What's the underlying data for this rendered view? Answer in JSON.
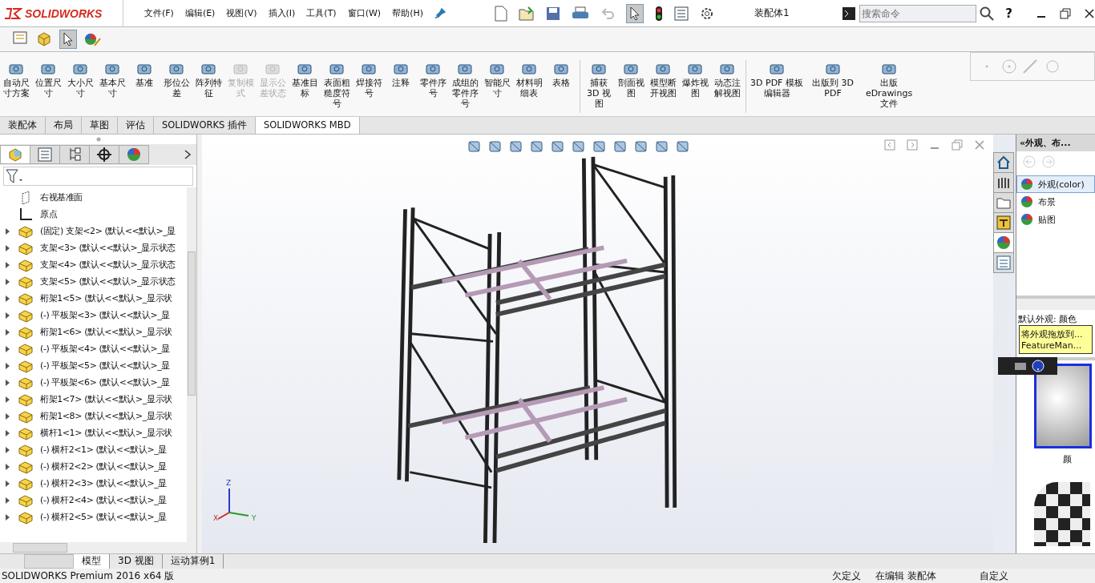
{
  "app": {
    "logo": "SOLIDWORKS",
    "menus": [
      "文件(F)",
      "编辑(E)",
      "视图(V)",
      "插入(I)",
      "工具(T)",
      "窗口(W)",
      "帮助(H)"
    ],
    "document_title": "装配体1",
    "search": {
      "placeholder": "搜索命令"
    },
    "help": "?"
  },
  "ribbon": {
    "groups": [
      [
        {
          "label": "自动尺寸方案",
          "disabled": false
        },
        {
          "label": "位置尺寸",
          "disabled": false
        },
        {
          "label": "大小尺寸",
          "disabled": false
        },
        {
          "label": "基本尺寸",
          "disabled": false
        },
        {
          "label": "基准",
          "disabled": false
        },
        {
          "label": "形位公差",
          "disabled": false
        },
        {
          "label": "阵列特征",
          "disabled": false
        },
        {
          "label": "复制模式",
          "disabled": true
        },
        {
          "label": "显示公差状态",
          "disabled": true
        },
        {
          "label": "基准目标",
          "disabled": false
        },
        {
          "label": "表面粗糙度符号",
          "disabled": false
        },
        {
          "label": "焊接符号",
          "disabled": false
        },
        {
          "label": "注释",
          "disabled": false
        },
        {
          "label": "零件序号",
          "disabled": false
        },
        {
          "label": "成组的零件序号",
          "disabled": false
        },
        {
          "label": "智能尺寸",
          "disabled": false
        },
        {
          "label": "材料明细表",
          "disabled": false
        },
        {
          "label": "表格",
          "disabled": false
        }
      ],
      [
        {
          "label": "捕获 3D 视图",
          "disabled": false
        },
        {
          "label": "剖面视图",
          "disabled": false
        },
        {
          "label": "模型断开视图",
          "disabled": false
        },
        {
          "label": "爆炸视图",
          "disabled": false
        },
        {
          "label": "动态注解视图",
          "disabled": false
        }
      ],
      [
        {
          "label": "3D PDF 模板编辑器",
          "disabled": false
        },
        {
          "label": "出版到 3D PDF",
          "disabled": false
        },
        {
          "label": "出版 eDrawings 文件",
          "disabled": false
        }
      ]
    ]
  },
  "command_tabs": [
    {
      "label": "装配体",
      "selected": false
    },
    {
      "label": "布局",
      "selected": false
    },
    {
      "label": "草图",
      "selected": false
    },
    {
      "label": "评估",
      "selected": false
    },
    {
      "label": "SOLIDWORKS 插件",
      "selected": false
    },
    {
      "label": "SOLIDWORKS MBD",
      "selected": true
    }
  ],
  "panel_tabs": [
    {
      "kind": "tree",
      "selected": true
    },
    {
      "kind": "properties",
      "selected": false
    },
    {
      "kind": "config",
      "selected": false
    },
    {
      "kind": "target",
      "selected": false
    },
    {
      "kind": "appearance",
      "selected": false
    }
  ],
  "feature_tree": [
    {
      "kind": "plane",
      "label": "右视基准面"
    },
    {
      "kind": "origin",
      "label": "原点"
    },
    {
      "kind": "component",
      "label": "(固定) 支架<2> (默认<<默认>_显"
    },
    {
      "kind": "component",
      "label": "支架<3> (默认<<默认>_显示状态"
    },
    {
      "kind": "component",
      "label": "支架<4> (默认<<默认>_显示状态"
    },
    {
      "kind": "component",
      "label": "支架<5> (默认<<默认>_显示状态"
    },
    {
      "kind": "component",
      "label": "桁架1<5> (默认<<默认>_显示状"
    },
    {
      "kind": "component",
      "label": "(-) 平板架<3> (默认<<默认>_显"
    },
    {
      "kind": "component",
      "label": "桁架1<6> (默认<<默认>_显示状"
    },
    {
      "kind": "component",
      "label": "(-) 平板架<4> (默认<<默认>_显"
    },
    {
      "kind": "component",
      "label": "(-) 平板架<5> (默认<<默认>_显"
    },
    {
      "kind": "component",
      "label": "(-) 平板架<6> (默认<<默认>_显"
    },
    {
      "kind": "component",
      "label": "桁架1<7> (默认<<默认>_显示状"
    },
    {
      "kind": "component",
      "label": "桁架1<8> (默认<<默认>_显示状"
    },
    {
      "kind": "component",
      "label": "横杆1<1> (默认<<默认>_显示状"
    },
    {
      "kind": "component",
      "label": "(-) 横杆2<1> (默认<<默认>_显"
    },
    {
      "kind": "component",
      "label": "(-) 横杆2<2> (默认<<默认>_显"
    },
    {
      "kind": "component",
      "label": "(-) 横杆2<3> (默认<<默认>_显"
    },
    {
      "kind": "component",
      "label": "(-) 横杆2<4> (默认<<默认>_显"
    },
    {
      "kind": "component",
      "label": "(-) 横杆2<5> (默认<<默认>_显"
    }
  ],
  "bottom_tabs": [
    {
      "label": "模型",
      "selected": true
    },
    {
      "label": "3D 视图",
      "selected": false
    },
    {
      "label": "运动算例1",
      "selected": false
    }
  ],
  "triad": {
    "x": "X",
    "y": "Y",
    "z": "Z"
  },
  "side_tabs": [
    {
      "kind": "home",
      "selected": false
    },
    {
      "kind": "library",
      "selected": false
    },
    {
      "kind": "folder",
      "selected": false
    },
    {
      "kind": "palette",
      "selected": false
    },
    {
      "kind": "appearance",
      "selected": true
    },
    {
      "kind": "list",
      "selected": false
    }
  ],
  "task_pane": {
    "title": "«外观、布...",
    "items": [
      {
        "label": "外观(color)",
        "selected": true
      },
      {
        "label": "布景",
        "selected": false
      },
      {
        "label": "贴图",
        "selected": false
      }
    ],
    "preview_title": "默认外观: 颜色",
    "tooltip": [
      "将外观拖放到...",
      "FeatureMan..."
    ],
    "swatch_label": "颜"
  },
  "status_bar": [
    "SOLIDWORKS Premium 2016 x64 版",
    "欠定义",
    "在编辑 装配体",
    "自定义"
  ]
}
